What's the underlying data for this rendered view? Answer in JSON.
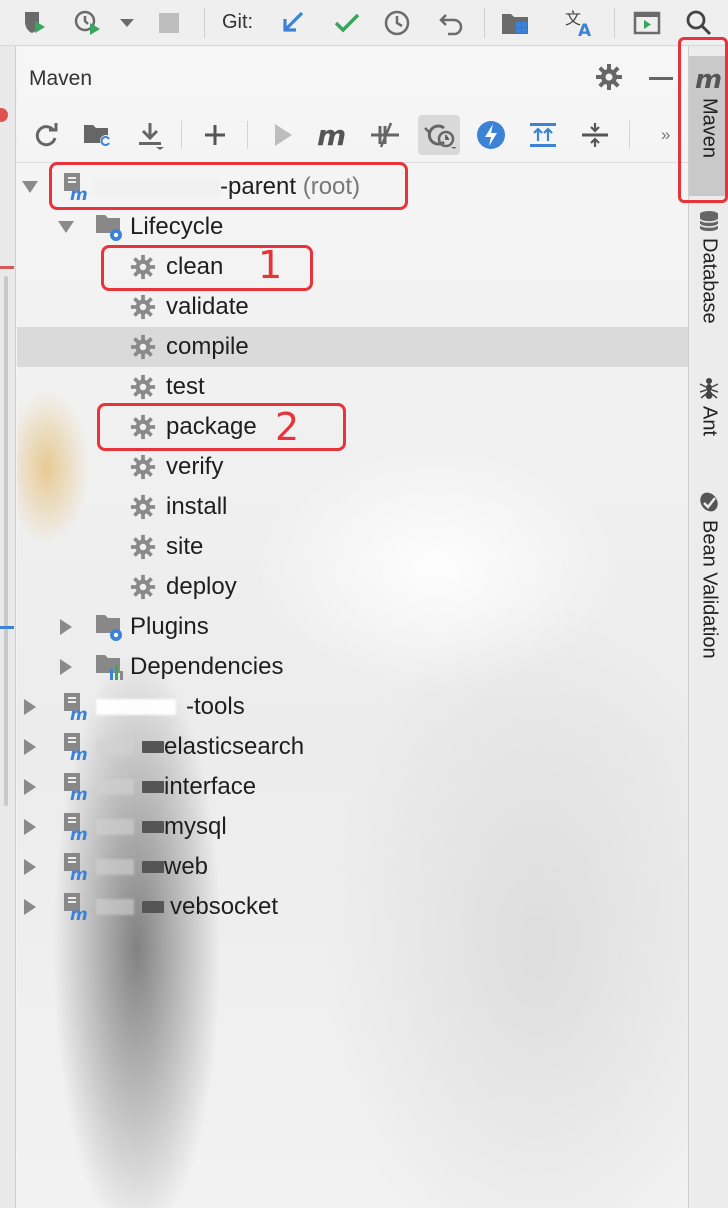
{
  "toolbar": {
    "git_label": "Git:"
  },
  "panel": {
    "title": "Maven",
    "more_label": "»"
  },
  "tree": {
    "root_label": "-parent",
    "root_suffix": "(root)",
    "lifecycle_label": "Lifecycle",
    "phases": [
      "clean",
      "validate",
      "compile",
      "test",
      "package",
      "verify",
      "install",
      "site",
      "deploy"
    ],
    "plugins_label": "Plugins",
    "dependencies_label": "Dependencies",
    "modules": [
      "-tools",
      "elasticsearch",
      "interface",
      "mysql",
      "web",
      "vebsocket"
    ]
  },
  "annotations": {
    "num1": "1",
    "num2": "2"
  },
  "right_tabs": [
    "Maven",
    "Database",
    "Ant",
    "Bean Validation"
  ],
  "colors": {
    "annotation_red": "#e8333a",
    "accent_blue": "#3c82d6",
    "check_green": "#3aa55c",
    "maven_m": "#555555"
  },
  "icons": {
    "module": "maven-module-icon",
    "phase": "gear-icon",
    "lifecycle": "lifecycle-folder-icon",
    "plugins": "plugins-folder-icon",
    "dependencies": "dependencies-folder-icon"
  }
}
